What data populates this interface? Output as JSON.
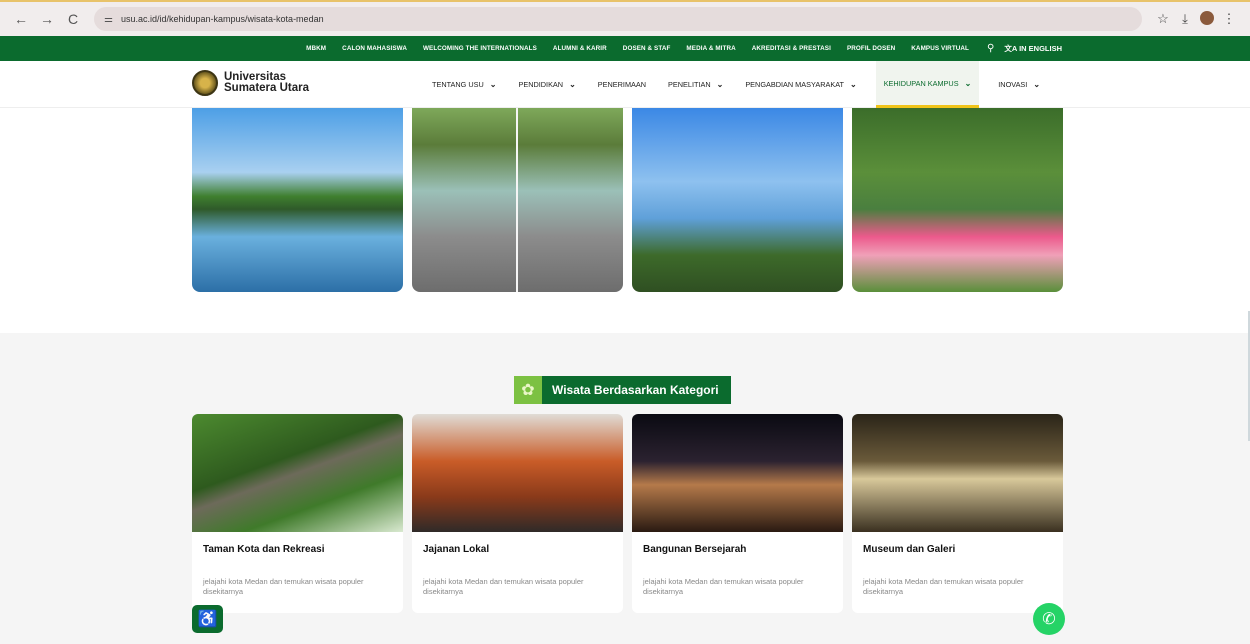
{
  "browser": {
    "url": "usu.ac.id/id/kehidupan-kampus/wisata-kota-medan",
    "back_icon": "←",
    "forward_icon": "→",
    "reload_icon": "C",
    "tune_icon": "⚌",
    "star_icon": "☆",
    "download_icon": "⤓",
    "menu_icon": "⋮"
  },
  "topbar": {
    "links": [
      "MBKM",
      "CALON MAHASISWA",
      "WELCOMING THE INTERNATIONALS",
      "ALUMNI & KARIR",
      "DOSEN & STAF",
      "MEDIA & MITRA",
      "AKREDITASI & PRESTASI",
      "PROFIL DOSEN",
      "KAMPUS VIRTUAL"
    ],
    "search_icon": "⚲",
    "lang_label": "文A IN ENGLISH"
  },
  "logo": {
    "line1": "Universitas",
    "line2": "Sumatera Utara"
  },
  "menu": {
    "items": [
      {
        "label": "TENTANG USU",
        "chev": "⌄"
      },
      {
        "label": "PENDIDIKAN",
        "chev": "⌄"
      },
      {
        "label": "PENERIMAAN",
        "chev": ""
      },
      {
        "label": "PENELITIAN",
        "chev": "⌄"
      },
      {
        "label": "PENGABDIAN MASYARAKAT",
        "chev": "⌄"
      },
      {
        "label": "KEHIDUPAN KAMPUS",
        "chev": "⌄"
      },
      {
        "label": "INOVASI",
        "chev": "⌄"
      }
    ],
    "active_index": 5
  },
  "category_section": {
    "title": "Wisata Berdasarkan Kategori",
    "icon": "✿",
    "cards": [
      {
        "title": "Taman Kota dan Rekreasi",
        "desc": "jelajahi kota Medan dan temukan wisata populer disekitarnya"
      },
      {
        "title": "Jajanan Lokal",
        "desc": "jelajahi kota Medan dan temukan wisata populer disekitarnya"
      },
      {
        "title": "Bangunan Bersejarah",
        "desc": "jelajahi kota Medan dan temukan wisata populer disekitarnya"
      },
      {
        "title": "Museum dan Galeri",
        "desc": "jelajahi kota Medan dan temukan wisata populer disekitarnya"
      }
    ]
  },
  "float": {
    "accessibility_icon": "♿",
    "whatsapp_icon": "✆"
  },
  "colors": {
    "brand_green": "#0b6b2e",
    "accent_yellow": "#f0c419",
    "whatsapp": "#25d366"
  }
}
